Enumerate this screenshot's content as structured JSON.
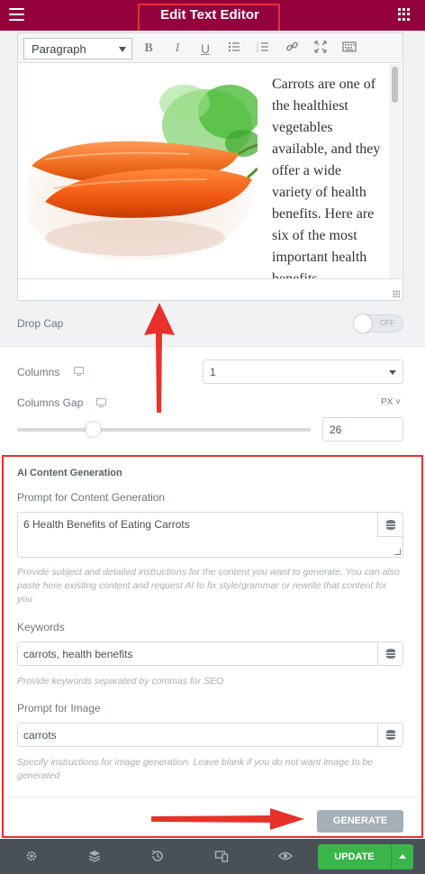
{
  "header": {
    "title": "Edit Text Editor"
  },
  "editor": {
    "format": "Paragraph",
    "toolbar": [
      "bold",
      "italic",
      "underline",
      "bulleted-list",
      "numbered-list",
      "link",
      "fullscreen",
      "keyboard"
    ],
    "content": "Carrots are one of the healthiest vegetables available, and they offer a wide variety of health benefits. Here are six of the most important health benefits"
  },
  "drop_cap": {
    "label": "Drop Cap",
    "toggle_text": "OFF"
  },
  "columns": {
    "label": "Columns",
    "value": "1"
  },
  "columns_gap": {
    "label": "Columns Gap",
    "unit": "PX",
    "value": "26",
    "slider_fraction": 0.26
  },
  "ai": {
    "section_title": "AI Content Generation",
    "prompt_label": "Prompt for Content Generation",
    "prompt_value": "6 Health Benefits of Eating Carrots",
    "prompt_help": "Provide subject and detailed instructions for the content you want to generate. You can also paste here existing content and request AI to fix style/grammar or rewrite that content for you",
    "keywords_label": "Keywords",
    "keywords_value": "carrots, health benefits",
    "keywords_help": "Provide keywords separated by commas for SEO",
    "image_label": "Prompt for Image",
    "image_value": "carrots",
    "image_help": "Specify instructions for image generation. Leave blank if you do not want image to be generated",
    "generate_label": "GENERATE"
  },
  "footer": {
    "update_label": "UPDATE",
    "icons": [
      "gear-icon",
      "layers-icon",
      "history-icon",
      "responsive-icon",
      "eye-icon"
    ]
  },
  "colors": {
    "header": "#93003c",
    "annotation": "#e8312b",
    "update": "#39b54a",
    "footer": "#495157"
  }
}
